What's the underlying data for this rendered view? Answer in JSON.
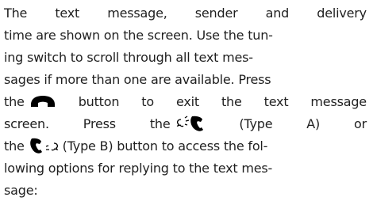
{
  "document": {
    "lines": {
      "l1": [
        "The",
        "text",
        "message,",
        "sender",
        "and",
        "delivery"
      ],
      "l2": "time are shown on the screen. Use the tun-",
      "l3": "ing switch to scroll through all text mes-",
      "l4": "sages if more than one are available. Press",
      "l5": {
        "pre": "the",
        "post_words": [
          "button",
          "to",
          "exit",
          "the",
          "text",
          "message"
        ]
      },
      "l6": [
        "screen.",
        "Press",
        "the",
        "(Type",
        "A)",
        "or"
      ],
      "l7": {
        "pre": "the",
        "post": "(Type B) button to access the fol-"
      },
      "l8": "lowing options for replying to the text mes-",
      "l9": "sage:"
    }
  },
  "icons": {
    "hangup": "phone-hangup-icon",
    "talk_phone": "voice-phone-icon",
    "phone_talk": "phone-voice-icon"
  },
  "colors": {
    "text": "#1f1f1f",
    "icon": "#000000"
  }
}
